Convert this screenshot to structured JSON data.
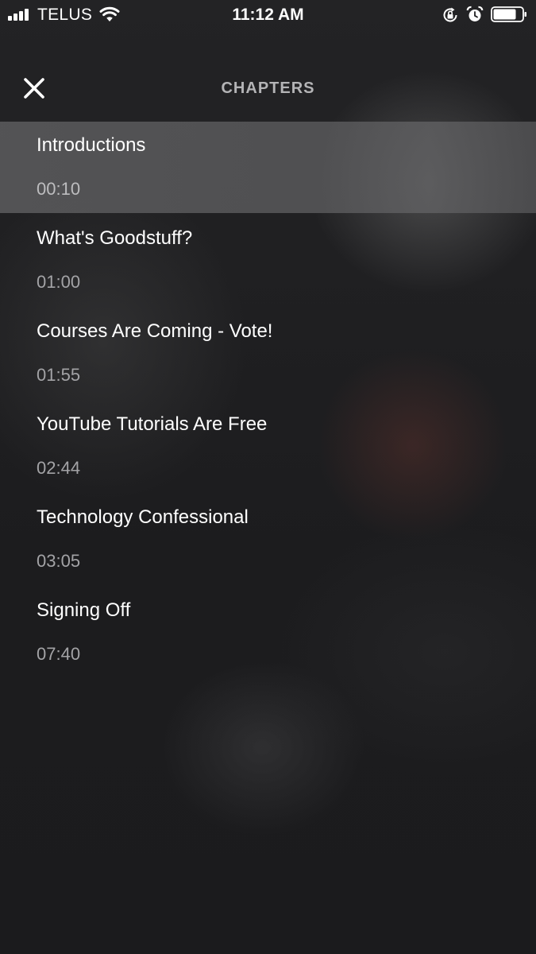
{
  "status_bar": {
    "carrier": "TELUS",
    "time": "11:12 AM",
    "signal_icon": "signal-bars-icon",
    "wifi_icon": "wifi-icon",
    "rotation_lock_icon": "rotation-lock-icon",
    "alarm_icon": "alarm-clock-icon",
    "battery_icon": "battery-icon",
    "battery_level": 0.8
  },
  "header": {
    "title": "CHAPTERS",
    "close_icon": "close-icon"
  },
  "chapters": [
    {
      "title": "Introductions",
      "time": "00:10",
      "selected": true
    },
    {
      "title": "What's Goodstuff?",
      "time": "01:00",
      "selected": false
    },
    {
      "title": "Courses Are Coming - Vote!",
      "time": "01:55",
      "selected": false
    },
    {
      "title": "YouTube Tutorials Are Free",
      "time": "02:44",
      "selected": false
    },
    {
      "title": "Technology Confessional",
      "time": "03:05",
      "selected": false
    },
    {
      "title": "Signing Off",
      "time": "07:40",
      "selected": false
    }
  ],
  "colors": {
    "background": "#1e1e20",
    "selected_row": "#5a5a5c",
    "title_text": "#b4b4b6",
    "time_text": "#a3a3a6"
  }
}
